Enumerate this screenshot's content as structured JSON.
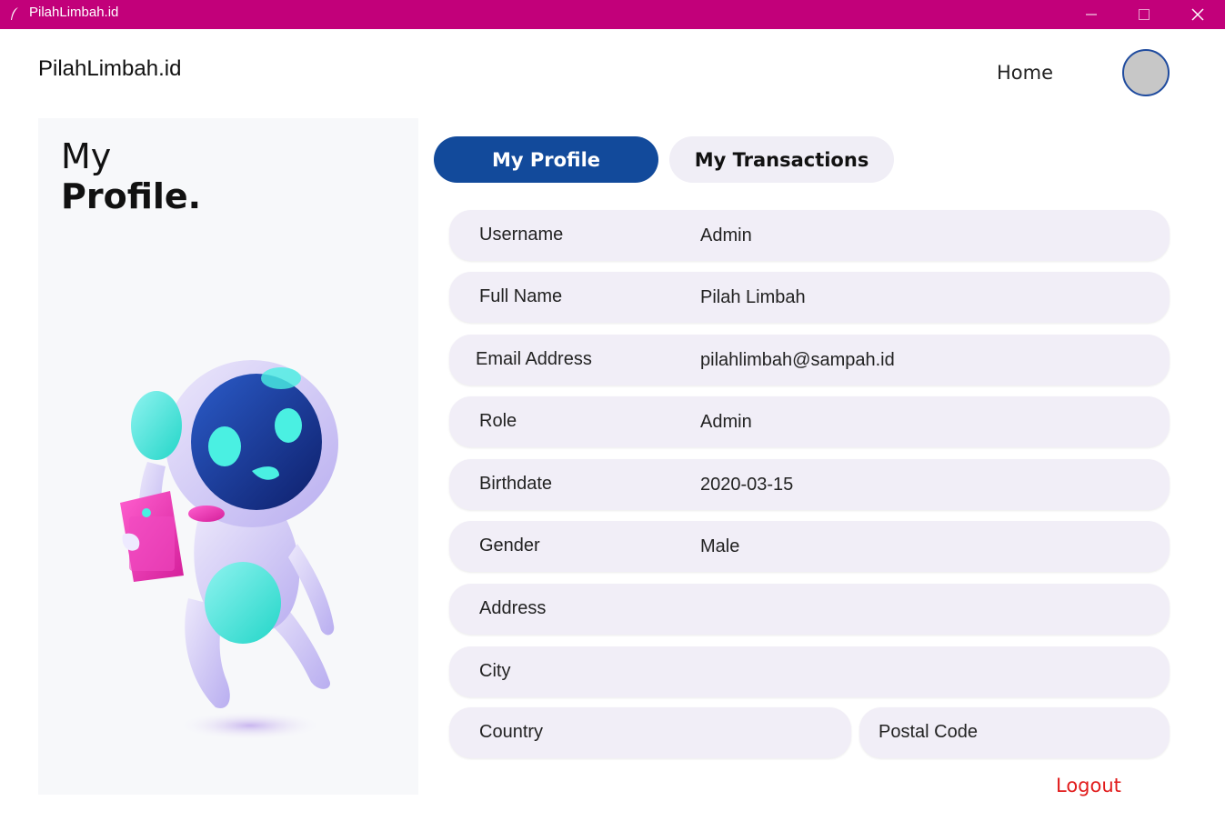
{
  "window": {
    "title": "PilahLimbah.id"
  },
  "header": {
    "brand": "PilahLimbah.id",
    "home_label": "Home"
  },
  "left_panel": {
    "title_line1": "My",
    "title_line2": "Profile."
  },
  "tabs": [
    {
      "label": "My Profile",
      "active": true
    },
    {
      "label": "My Transactions",
      "active": false
    }
  ],
  "profile": {
    "username": {
      "label": "Username",
      "value": "Admin"
    },
    "full_name": {
      "label": "Full Name",
      "value": "Pilah Limbah"
    },
    "email": {
      "label": "Email Address",
      "value": "pilahlimbah@sampah.id"
    },
    "role": {
      "label": "Role",
      "value": "Admin"
    },
    "birthdate": {
      "label": "Birthdate",
      "value": "2020-03-15"
    },
    "gender": {
      "label": "Gender",
      "value": "Male"
    },
    "address": {
      "label": "Address",
      "value": ""
    },
    "city": {
      "label": "City",
      "value": ""
    },
    "country": {
      "label": "Country",
      "value": ""
    },
    "postal_code": {
      "label": "Postal Code",
      "value": ""
    }
  },
  "logout_label": "Logout",
  "colors": {
    "titlebar": "#c2007a",
    "primary": "#124a9b",
    "field_bg": "#f1eef7",
    "logout": "#e11b1b"
  }
}
